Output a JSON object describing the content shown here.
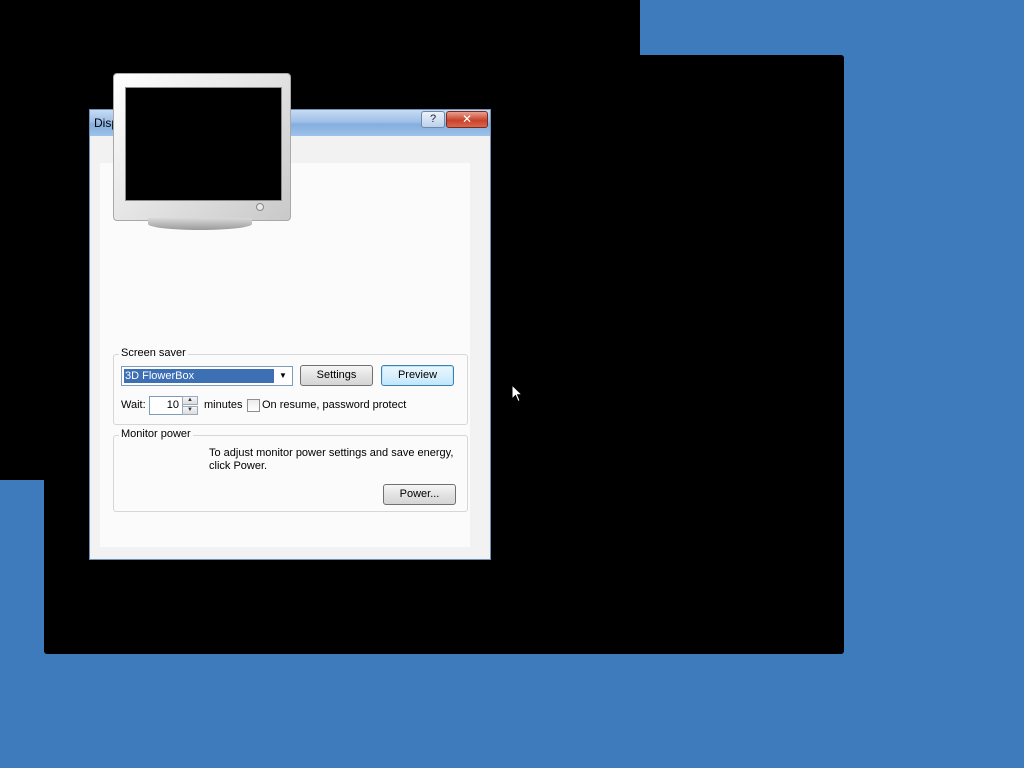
{
  "window": {
    "title": "Display Properties",
    "help_glyph": "?",
    "close_glyph": "✕"
  },
  "screen_saver": {
    "group_label": "Screen saver",
    "selected": "3D FlowerBox",
    "settings_label": "Settings",
    "preview_label": "Preview",
    "wait_label": "Wait:",
    "wait_value": "10",
    "minutes_label": "minutes",
    "password_label": "On resume, password protect",
    "password_checked": false
  },
  "monitor_power": {
    "group_label": "Monitor power",
    "description": "To adjust monitor power settings and save energy, click Power.",
    "power_label": "Power..."
  },
  "colors": {
    "desktop": "#3e7bbd",
    "selection": "#3d6fb5"
  }
}
